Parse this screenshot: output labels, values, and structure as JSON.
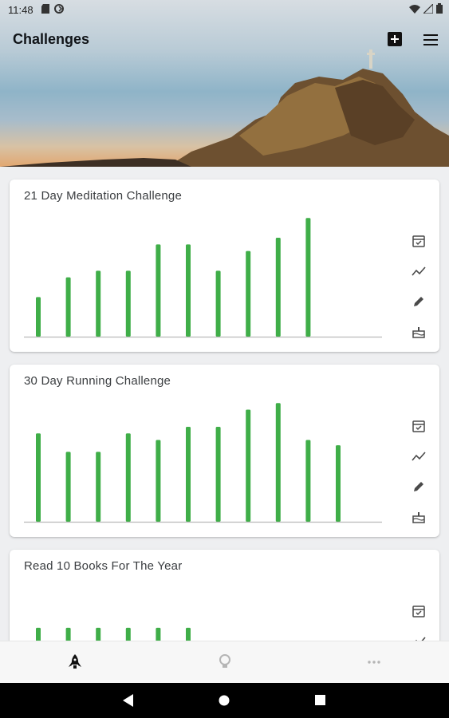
{
  "status_bar": {
    "time": "11:48"
  },
  "header": {
    "title": "Challenges",
    "add_icon": "add-box-icon",
    "menu_icon": "menu-icon"
  },
  "colors": {
    "bar": "#3fae48",
    "baseline": "#b9b9b9"
  },
  "challenges": [
    {
      "title": "21 Day Meditation Challenge",
      "chart_data": {
        "type": "bar",
        "series": [
          {
            "values": [
              30,
              45,
              50,
              50,
              70,
              70,
              50,
              65,
              75,
              90
            ]
          }
        ],
        "ylim": [
          0,
          95
        ]
      }
    },
    {
      "title": "30 Day Running Challenge",
      "chart_data": {
        "type": "bar",
        "series": [
          {
            "values": [
              67,
              53,
              53,
              67,
              62,
              72,
              72,
              85,
              90,
              62,
              58
            ]
          }
        ],
        "ylim": [
          0,
          95
        ]
      }
    },
    {
      "title": "Read 10 Books For The Year",
      "chart_data": {
        "type": "bar",
        "series": [
          {
            "values": [
              60,
              60,
              60,
              60,
              60,
              60
            ]
          }
        ],
        "ylim": [
          0,
          95
        ]
      }
    }
  ],
  "card_actions": [
    "calendar-check-icon",
    "trend-icon",
    "edit-icon",
    "cake-icon"
  ],
  "bottom_nav": [
    "rocket-icon",
    "lightbulb-icon",
    "more-horiz-icon"
  ],
  "system_nav": [
    "back-icon",
    "home-icon",
    "recents-icon"
  ]
}
